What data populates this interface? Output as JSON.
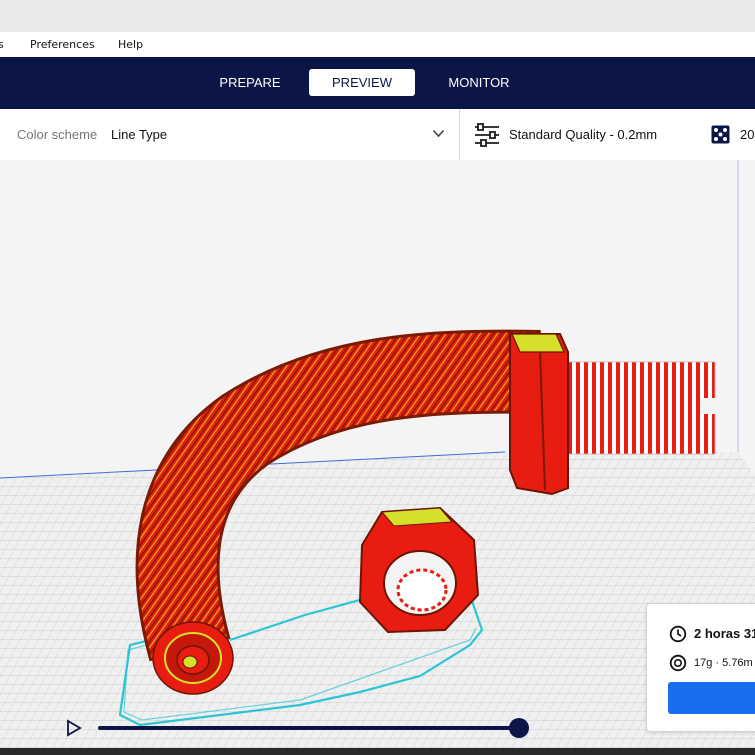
{
  "menu": {
    "items": [
      {
        "label": "s"
      },
      {
        "label": "Preferences"
      },
      {
        "label": "Help"
      }
    ]
  },
  "stages": [
    {
      "label": "PREPARE",
      "active": false
    },
    {
      "label": "PREVIEW",
      "active": true
    },
    {
      "label": "MONITOR",
      "active": false
    }
  ],
  "toolbar": {
    "color_scheme_label": "Color scheme",
    "color_scheme_value": "Line Type",
    "print_settings_label": "Standard Quality - 0.2mm",
    "support_value": "20"
  },
  "job": {
    "print_time": "2 horas 31",
    "material_estimate": "17g · 5.76m"
  },
  "colors": {
    "header_bg": "#0b1646",
    "accent_blue": "#196ef0",
    "model_red": "#e81c10",
    "model_yellow": "#d4e02a",
    "travel_cyan": "#2bc5d3",
    "slider_track": "#0b1646"
  },
  "icons": {
    "dropdown": "chevron-down-icon",
    "print_settings": "sliders-icon",
    "support": "support-icon",
    "time": "clock-icon",
    "material": "spool-icon",
    "play": "play-icon"
  }
}
